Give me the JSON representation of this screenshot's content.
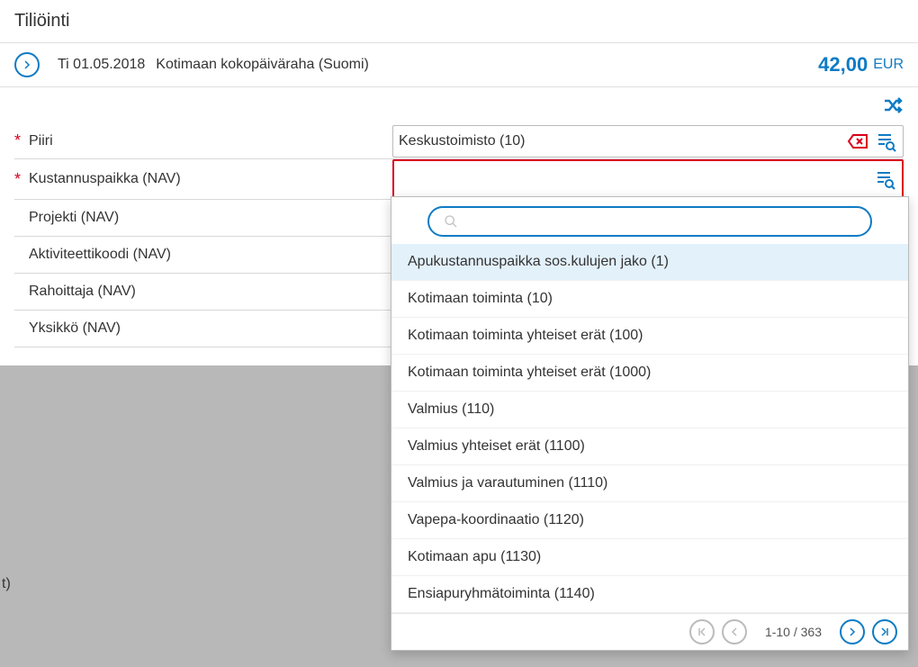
{
  "header": {
    "title": "Tiliöinti"
  },
  "summary": {
    "date": "Ti 01.05.2018",
    "description": "Kotimaan kokopäiväraha (Suomi)",
    "amount": "42,00",
    "currency": "EUR"
  },
  "form": {
    "rows": [
      {
        "label": "Piiri",
        "required": true,
        "value": "Keskustoimisto (10)",
        "hasClear": true,
        "hasLookup": true,
        "bordered": true
      },
      {
        "label": "Kustannuspaikka (NAV)",
        "required": true,
        "value": "",
        "hasClear": false,
        "hasLookup": true,
        "error": true
      },
      {
        "label": "Projekti (NAV)",
        "required": false,
        "value": ""
      },
      {
        "label": "Aktiviteettikoodi (NAV)",
        "required": false,
        "value": ""
      },
      {
        "label": "Rahoittaja (NAV)",
        "required": false,
        "value": ""
      },
      {
        "label": "Yksikkö (NAV)",
        "required": false,
        "value": ""
      }
    ]
  },
  "dropdown": {
    "searchValue": "",
    "items": [
      {
        "label": "Apukustannuspaikka sos.kulujen jako (1)",
        "highlighted": true
      },
      {
        "label": "Kotimaan toiminta (10)"
      },
      {
        "label": "Kotimaan toiminta yhteiset erät (100)"
      },
      {
        "label": "Kotimaan toiminta yhteiset erät (1000)"
      },
      {
        "label": "Valmius (110)"
      },
      {
        "label": "Valmius yhteiset erät (1100)"
      },
      {
        "label": "Valmius ja varautuminen (1110)"
      },
      {
        "label": "Vapepa-koordinaatio (1120)"
      },
      {
        "label": "Kotimaan apu (1130)"
      },
      {
        "label": "Ensiapuryhmätoiminta (1140)"
      }
    ],
    "pager": {
      "info": "1-10 / 363"
    }
  },
  "partial": {
    "bottomText": "t)"
  }
}
